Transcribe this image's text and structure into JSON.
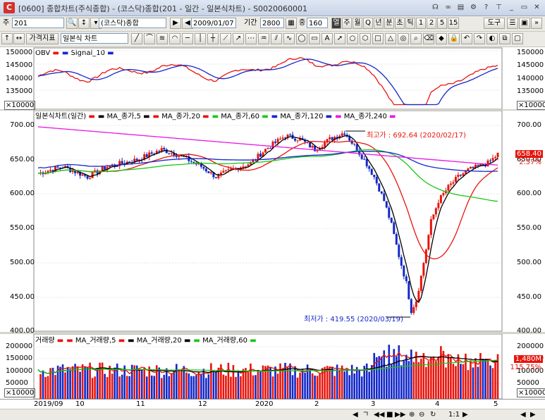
{
  "window": {
    "title": "[0600] 종합차트(주식종합) - (코스닥)종합(201 - 일간 - 일본식차트) - S0020060001",
    "icon_letter": "C"
  },
  "toolbar1": {
    "type_label": "주",
    "code_value": "201",
    "name_value": "(코스닥)종합",
    "date_value": "2009/01/07",
    "period_label": "기간",
    "period_value": "2800",
    "count_label": "중",
    "count_value": "160",
    "period_buttons": [
      "열",
      "주",
      "월",
      "Q",
      "년",
      "분",
      "초",
      "틱",
      "1",
      "2",
      "5",
      "15"
    ],
    "tool_label": "도구"
  },
  "toolbar2": {
    "indicator_btn": "가격지표",
    "chart_type": "일본식 차트"
  },
  "obv_panel": {
    "legend": [
      {
        "name": "OBV",
        "color": "#e8140c"
      },
      {
        "name": "Signal_10",
        "color": "#1428c8"
      }
    ],
    "ticks": [
      "150000",
      "145000",
      "140000",
      "135000"
    ],
    "unit": "×10000"
  },
  "price_panel": {
    "legend": [
      {
        "name": "일본식차트(일간)",
        "color": "#e8140c"
      },
      {
        "name": "MA_종가,5",
        "color": "#000000"
      },
      {
        "name": "MA_종가,20",
        "color": "#e8140c"
      },
      {
        "name": "MA_종가,60",
        "color": "#19c819"
      },
      {
        "name": "MA_종가,120",
        "color": "#1428c8"
      },
      {
        "name": "MA_종가,240",
        "color": "#e619e6"
      }
    ],
    "ticks": [
      "700.00",
      "650.00",
      "600.00",
      "550.00",
      "500.00",
      "450.00",
      "400.00"
    ],
    "right_ticks": [
      "700.00",
      "650.00",
      "600.00",
      "550.00",
      "500.00",
      "450.00",
      "400.00"
    ],
    "high_label": "최고가 : 692.64 (2020/02/17)",
    "low_label": "최저가 : 419.55 (2020/03/19)",
    "last_price": "658.40",
    "change_pct": "2.57%"
  },
  "volume_panel": {
    "legend": [
      {
        "name": "거래량",
        "color": "#e8140c"
      },
      {
        "name": "MA_거래량,5",
        "color": "#e8140c"
      },
      {
        "name": "MA_거래량,20",
        "color": "#000000"
      },
      {
        "name": "MA_거래량,60",
        "color": "#19c819"
      }
    ],
    "ticks": [
      "200000",
      "150000",
      "100000",
      "50000"
    ],
    "unit": "×10000",
    "last_volume": "1,480M",
    "vol_pct": "115.75%"
  },
  "date_axis": [
    "2019/09",
    "10",
    "11",
    "12",
    "2020",
    "2",
    "3",
    "4",
    "5"
  ],
  "statusbar": {
    "ratio": "1:1"
  },
  "colors": {
    "up": "#e8140c",
    "down": "#1428c8"
  }
}
